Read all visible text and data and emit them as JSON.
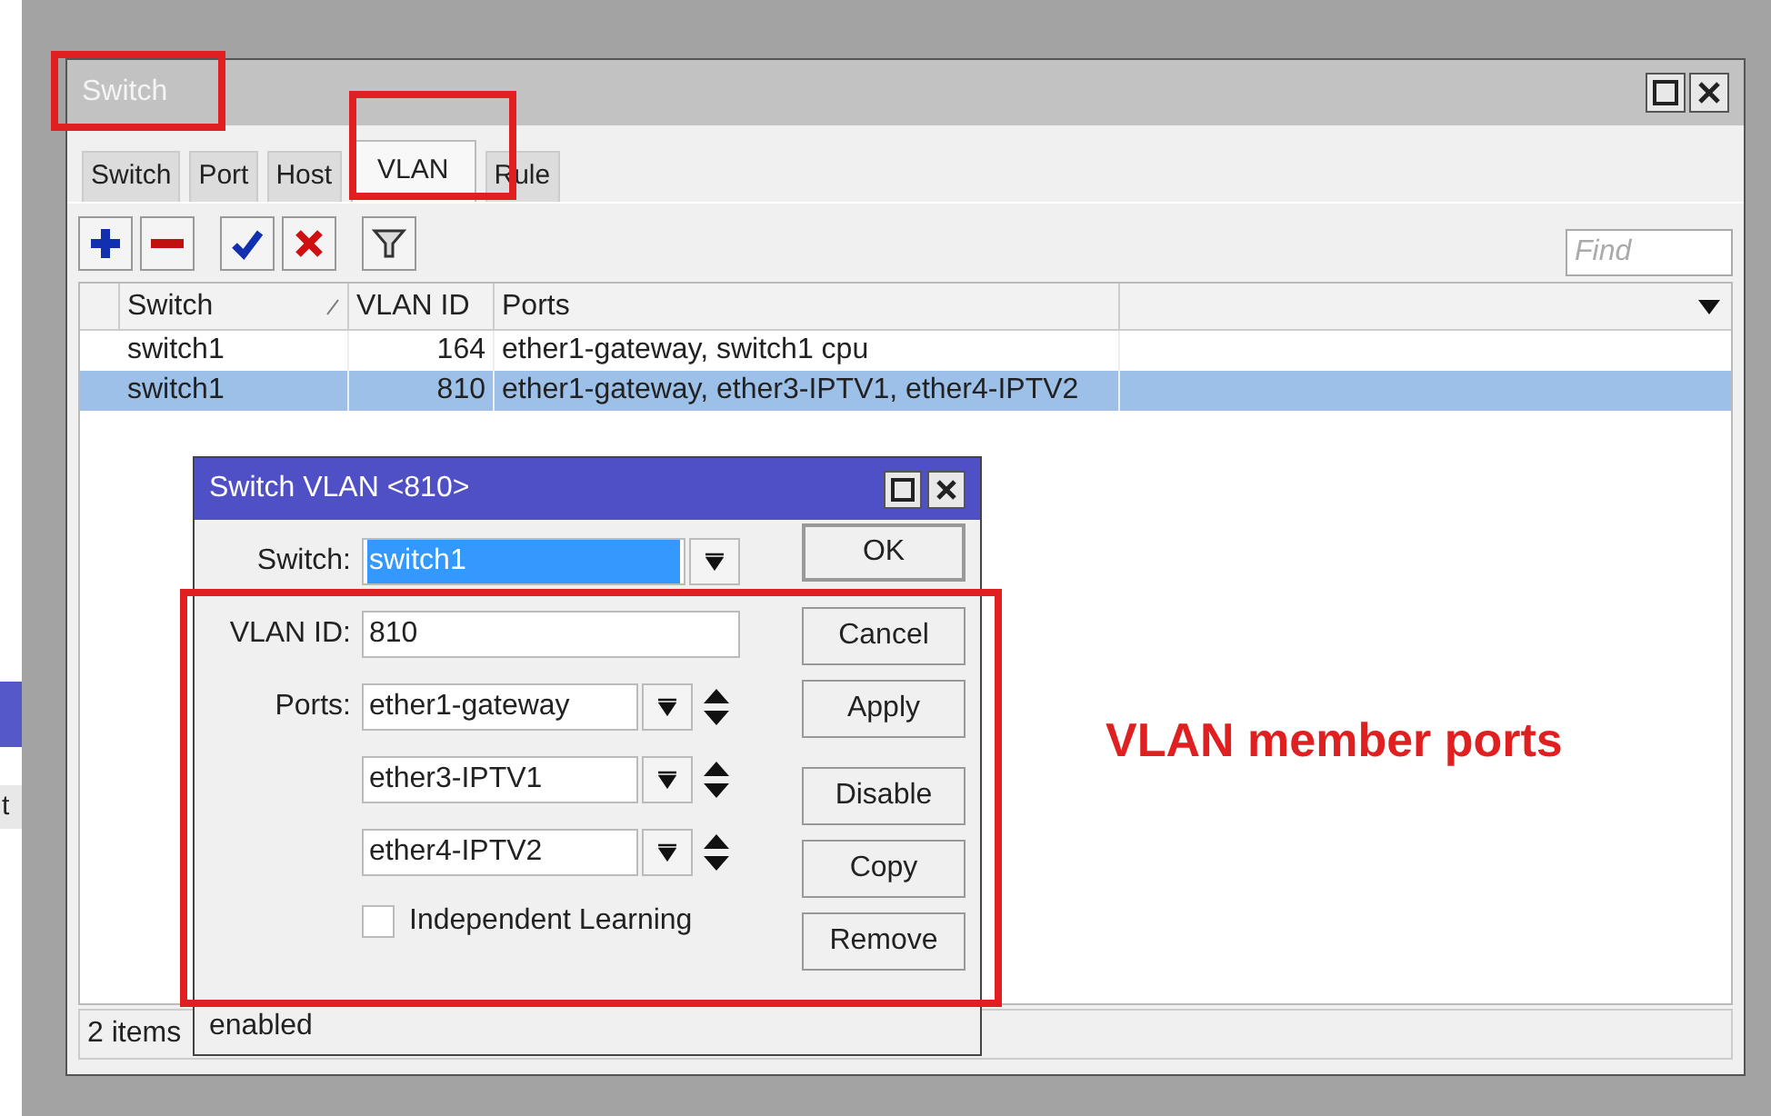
{
  "background_window": {
    "text": "t"
  },
  "window": {
    "title": "Switch"
  },
  "tabs": [
    {
      "label": "Switch",
      "selected": false
    },
    {
      "label": "Port",
      "selected": false
    },
    {
      "label": "Host",
      "selected": false
    },
    {
      "label": "VLAN",
      "selected": true
    },
    {
      "label": "Rule",
      "selected": false
    }
  ],
  "find": {
    "placeholder": "Find"
  },
  "table": {
    "columns": [
      "Switch",
      "VLAN ID",
      "Ports"
    ],
    "rows": [
      {
        "cells": [
          "switch1",
          "164",
          "ether1-gateway, switch1 cpu"
        ],
        "selected": false
      },
      {
        "cells": [
          "switch1",
          "810",
          "ether1-gateway, ether3-IPTV1, ether4-IPTV2"
        ],
        "selected": true
      }
    ]
  },
  "status_bar": "2 items",
  "dialog": {
    "title": "Switch VLAN <810>",
    "switch": {
      "label": "Switch:",
      "value": "switch1"
    },
    "vlan_id": {
      "label": "VLAN ID:",
      "value": "810"
    },
    "ports": {
      "label": "Ports:",
      "values": [
        "ether1-gateway",
        "ether3-IPTV1",
        "ether4-IPTV2"
      ]
    },
    "independent_learning": {
      "label": "Independent Learning",
      "checked": false
    },
    "buttons": [
      "OK",
      "Cancel",
      "Apply",
      "Disable",
      "Copy",
      "Remove"
    ],
    "status": "enabled"
  },
  "annotation": "VLAN member ports"
}
